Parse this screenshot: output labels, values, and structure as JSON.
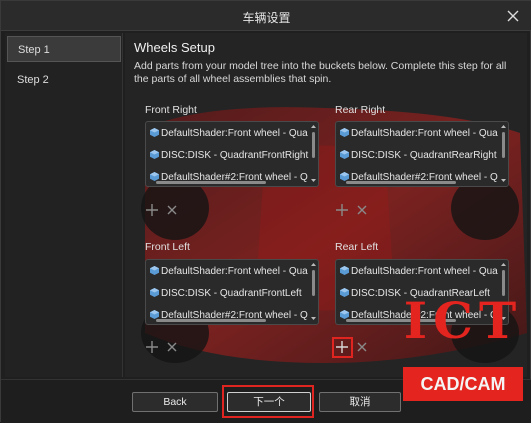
{
  "window": {
    "title": "车辆设置"
  },
  "sidebar": {
    "steps": [
      {
        "label": "Step 1",
        "active": true
      },
      {
        "label": "Step 2",
        "active": false
      }
    ]
  },
  "main": {
    "heading": "Wheels Setup",
    "description": "Add parts from your model tree into the buckets below. Complete this step for all the parts of all wheel assemblies that spin."
  },
  "buckets": {
    "front_right": {
      "label": "Front Right",
      "items": [
        "DefaultShader:Front wheel - Qua",
        "DISC:DISK - QuadrantFrontRight",
        "DefaultShader#2:Front wheel - Q"
      ]
    },
    "rear_right": {
      "label": "Rear Right",
      "items": [
        "DefaultShader:Front wheel - Qua",
        "DISC:DISK - QuadrantRearRight",
        "DefaultShader#2:Front wheel - Q"
      ]
    },
    "front_left": {
      "label": "Front Left",
      "items": [
        "DefaultShader:Front wheel - Qua",
        "DISC:DISK - QuadrantFrontLeft",
        "DefaultShader#2:Front wheel - Q"
      ]
    },
    "rear_left": {
      "label": "Rear Left",
      "items": [
        "DefaultShader:Front wheel - Qua",
        "DISC:DISK - QuadrantRearLeft",
        "DefaultShader#2:Front wheel - Q"
      ]
    }
  },
  "footer": {
    "back_label": "Back",
    "next_label": "下一个",
    "cancel_label": "取消"
  },
  "watermark": {
    "big": "ICT",
    "small": "CAD/CAM"
  },
  "colors": {
    "accent_red": "#e0241f",
    "cube_blue": "#5a9bd5"
  },
  "icons": [
    "close-icon",
    "cube-icon",
    "add-icon",
    "remove-icon",
    "scroll-up-icon",
    "scroll-down-icon"
  ]
}
